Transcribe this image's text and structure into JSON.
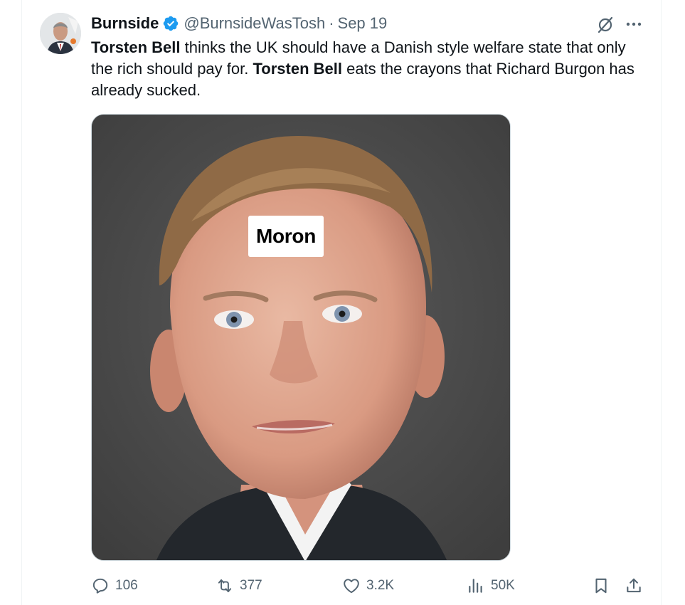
{
  "tweet": {
    "display_name": "Burnside",
    "handle": "@BurnsideWasTosh",
    "separator": "·",
    "date": "Sep 19",
    "text": {
      "p1_bold": "Torsten Bell",
      "p1": " thinks the UK should have a Danish style welfare state that only the rich should pay for. ",
      "p2_bold": "Torsten Bell",
      "p2": " eats the crayons that Richard Burgon has already sucked."
    },
    "media": {
      "overlay_label": "Moron"
    },
    "stats": {
      "replies": "106",
      "reposts": "377",
      "likes": "3.2K",
      "views": "50K"
    }
  },
  "colors": {
    "verified": "#1d9bf0",
    "muted": "#536471",
    "text": "#0f1419"
  },
  "icons": [
    "verified-badge-icon",
    "grok-icon",
    "more-icon",
    "reply-icon",
    "repost-icon",
    "like-icon",
    "views-icon",
    "bookmark-icon",
    "share-icon"
  ]
}
